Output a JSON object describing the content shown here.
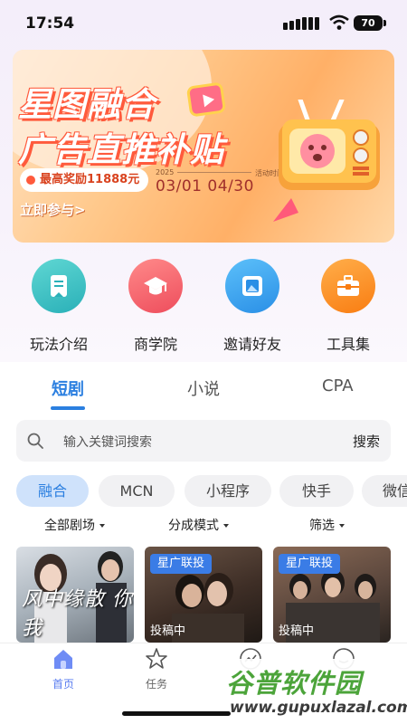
{
  "status_bar": {
    "time": "17:54",
    "battery": "70"
  },
  "banner": {
    "title_line1": "星图融合",
    "title_line2": "广告直推补贴",
    "reward_text": "最高奖励11888元",
    "year_label": "2025",
    "activity_label": "活动时间·Time",
    "date_range": "03/01 04/30",
    "cta": "立即参与>"
  },
  "quick_actions": [
    {
      "label": "玩法介绍",
      "icon": "bookmark-icon",
      "color": "#3cc3c4"
    },
    {
      "label": "商学院",
      "icon": "graduation-cap-icon",
      "color": "#f4646c"
    },
    {
      "label": "邀请好友",
      "icon": "picture-icon",
      "color": "#3aa8ee"
    },
    {
      "label": "工具集",
      "icon": "toolbox-icon",
      "color": "#fb8a1f"
    }
  ],
  "tabs": [
    "短剧",
    "小说",
    "CPA"
  ],
  "search": {
    "placeholder": "输入关键词搜索",
    "button": "搜索"
  },
  "chips": [
    "融合",
    "MCN",
    "小程序",
    "快手",
    "微信"
  ],
  "filters": [
    "全部剧场",
    "分成模式",
    "筛选"
  ],
  "cards": [
    {
      "tag": "",
      "status": "",
      "art_text": "风中缘散 你我"
    },
    {
      "tag": "星广联投",
      "status": "投稿中"
    },
    {
      "tag": "星广联投",
      "status": "投稿中"
    }
  ],
  "bottom_nav": [
    {
      "label": "首页",
      "icon": "home-icon",
      "active": true
    },
    {
      "label": "任务",
      "icon": "star-icon",
      "active": false
    },
    {
      "label": "",
      "icon": "trend-icon",
      "active": false
    },
    {
      "label": "",
      "icon": "smile-icon",
      "active": false
    }
  ],
  "watermark": {
    "title": "谷普软件园",
    "url": "www.gupuxlazal.com"
  },
  "colors": {
    "accent": "#2b7fe0",
    "banner_red": "#ff5a3c",
    "nav_active": "#5a7df0"
  }
}
